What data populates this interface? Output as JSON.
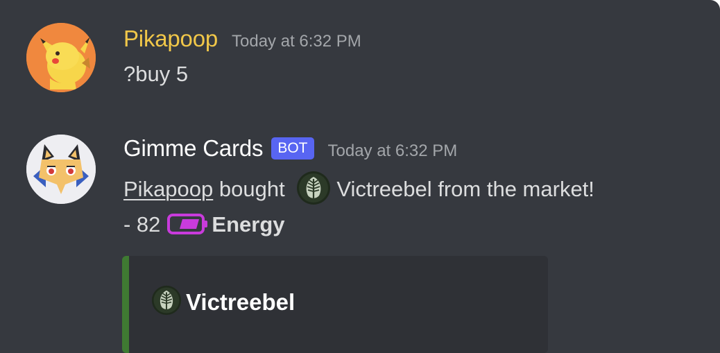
{
  "messages": [
    {
      "username": "Pikapoop",
      "timestamp": "Today at 6:32 PM",
      "text": "?buy 5",
      "avatar_icon": "pikachu-avatar-icon",
      "username_color": "#f1c749"
    },
    {
      "username": "Gimme Cards",
      "bot_tag": "BOT",
      "timestamp": "Today at 6:32 PM",
      "avatar_icon": "fox-avatar-icon",
      "line1": {
        "mention": "Pikapoop",
        "text_bought": " bought ",
        "card_icon": "grass-leaf-icon",
        "card_text": "Victreebel from the market!"
      },
      "line2": {
        "prefix": "- 82",
        "currency_icon": "energy-battery-icon",
        "currency": "Energy"
      },
      "embed": {
        "title": "Victreebel",
        "title_icon": "grass-leaf-icon",
        "accent_color": "#3f7a32"
      }
    }
  ],
  "colors": {
    "background": "#36393f",
    "embed_background": "#2f3136",
    "bot_tag": "#5865f2",
    "energy": "#c93bdc"
  }
}
